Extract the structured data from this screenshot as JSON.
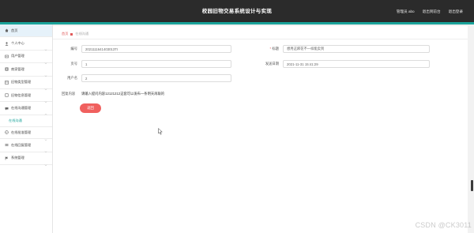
{
  "header": {
    "title": "校园旧物交易系统设计与实现",
    "links": [
      "管理员 abo",
      "退出到前台",
      "退出登录"
    ]
  },
  "sidebar": {
    "items": [
      {
        "label": "首页",
        "icon": "home-icon"
      },
      {
        "label": "个人中心",
        "icon": "user-icon"
      },
      {
        "label": "用户管理",
        "icon": "users-icon"
      },
      {
        "label": "商家管理",
        "icon": "store-icon"
      },
      {
        "label": "旧物类型管理",
        "icon": "tag-icon"
      },
      {
        "label": "旧物信息管理",
        "icon": "box-icon"
      },
      {
        "label": "在线沟通管理",
        "icon": "chat-icon"
      }
    ],
    "sub_item": "在线沟通",
    "items_after": [
      {
        "label": "在线批准管理",
        "icon": "check-icon"
      },
      {
        "label": "在线回复管理",
        "icon": "list-icon"
      },
      {
        "label": "系统管理",
        "icon": "flag-icon"
      }
    ]
  },
  "breadcrumb": {
    "home": "首页",
    "current": "在线沟通"
  },
  "form": {
    "number_label": "编号",
    "number_value": "2021111641403013TI",
    "title_label": "标题",
    "title_value": "想用这麻花不一样能卖到",
    "title_required": "*",
    "page_label": "页号",
    "page_value": "1",
    "time_label": "发送日期",
    "time_value": "2021-11-31 15:41:29",
    "user_label": "用户名",
    "user_value": "2",
    "content_label": "回复内容",
    "content_value": "请输入提问内容12121212这套可以发布一条明天再联的"
  },
  "buttons": {
    "back": "返回"
  },
  "watermark": "CSDN @CK3011",
  "colors": {
    "accent": "#1aa39a",
    "topbar": "#2b2b2b",
    "button": "#f0605e"
  }
}
